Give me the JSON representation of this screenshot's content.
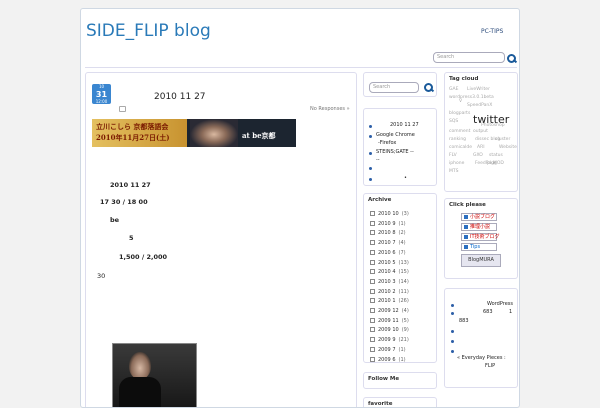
{
  "header": {
    "title": "SIDE_FLIP blog",
    "link": "PC-TIPS",
    "search_placeholder": "Search"
  },
  "post": {
    "date": {
      "month": "10",
      "day": "31",
      "time": "12:00"
    },
    "title": "2010 11 27",
    "comments": "No Responses »",
    "banner": {
      "line1": "立川こしら 京都落語会",
      "line2": "2010年11月27日(土)",
      "at": "at be京都"
    },
    "lines": [
      "2010  11  27",
      "17  30 /      18  00",
      "be",
      "5",
      "1,500   /      2,000",
      "30"
    ]
  },
  "sidebar": {
    "search_placeholder": "Search",
    "recent": [
      "2010 11 27",
      "Google Chrome",
      "-Firefox",
      "STEINS;GATE --",
      "--",
      "•"
    ],
    "archive_title": "Archive",
    "archive": [
      {
        "label": "2010 10",
        "count": "(3)"
      },
      {
        "label": "2010 9",
        "count": "(1)"
      },
      {
        "label": "2010 8",
        "count": "(2)"
      },
      {
        "label": "2010 7",
        "count": "(4)"
      },
      {
        "label": "2010 6",
        "count": "(7)"
      },
      {
        "label": "2010 5",
        "count": "(13)"
      },
      {
        "label": "2010 4",
        "count": "(15)"
      },
      {
        "label": "2010 3",
        "count": "(14)"
      },
      {
        "label": "2010 2",
        "count": "(11)"
      },
      {
        "label": "2010 1",
        "count": "(26)"
      },
      {
        "label": "2009 12",
        "count": "(4)"
      },
      {
        "label": "2009 11",
        "count": "(5)"
      },
      {
        "label": "2009 10",
        "count": "(9)"
      },
      {
        "label": "2009 9",
        "count": "(21)"
      },
      {
        "label": "2009 7",
        "count": "(1)"
      },
      {
        "label": "2009 6",
        "count": "(1)"
      }
    ],
    "follow_title": "Follow Me",
    "fav_title": "favorite",
    "tag_title": "Tag cloud",
    "tags": [
      "GAE",
      "LiveWriter",
      "wordpress3.0.1beta",
      "V",
      "SpeedPanX",
      "blogparts",
      "twitter",
      "SQS",
      "Photoshop",
      "comment",
      "output",
      "ranking",
      "dissec blog",
      "cluster",
      "comicalde",
      "ARI",
      "Website",
      "FLV",
      "GXO",
      "status",
      "iphone",
      "FeedPage",
      "plug",
      "MOD",
      "MTS",
      "threedo"
    ],
    "click_title": "Click please",
    "click_items": [
      "小説ブログ",
      "推理小説",
      "IT技術ブログ",
      "Tips"
    ],
    "blogmura": "BlogMURA",
    "links": [
      "WordPress",
      "683",
      "1",
      "883",
      "•",
      "•",
      "•",
      "« Everyday Pieces :",
      "FLIP"
    ]
  }
}
